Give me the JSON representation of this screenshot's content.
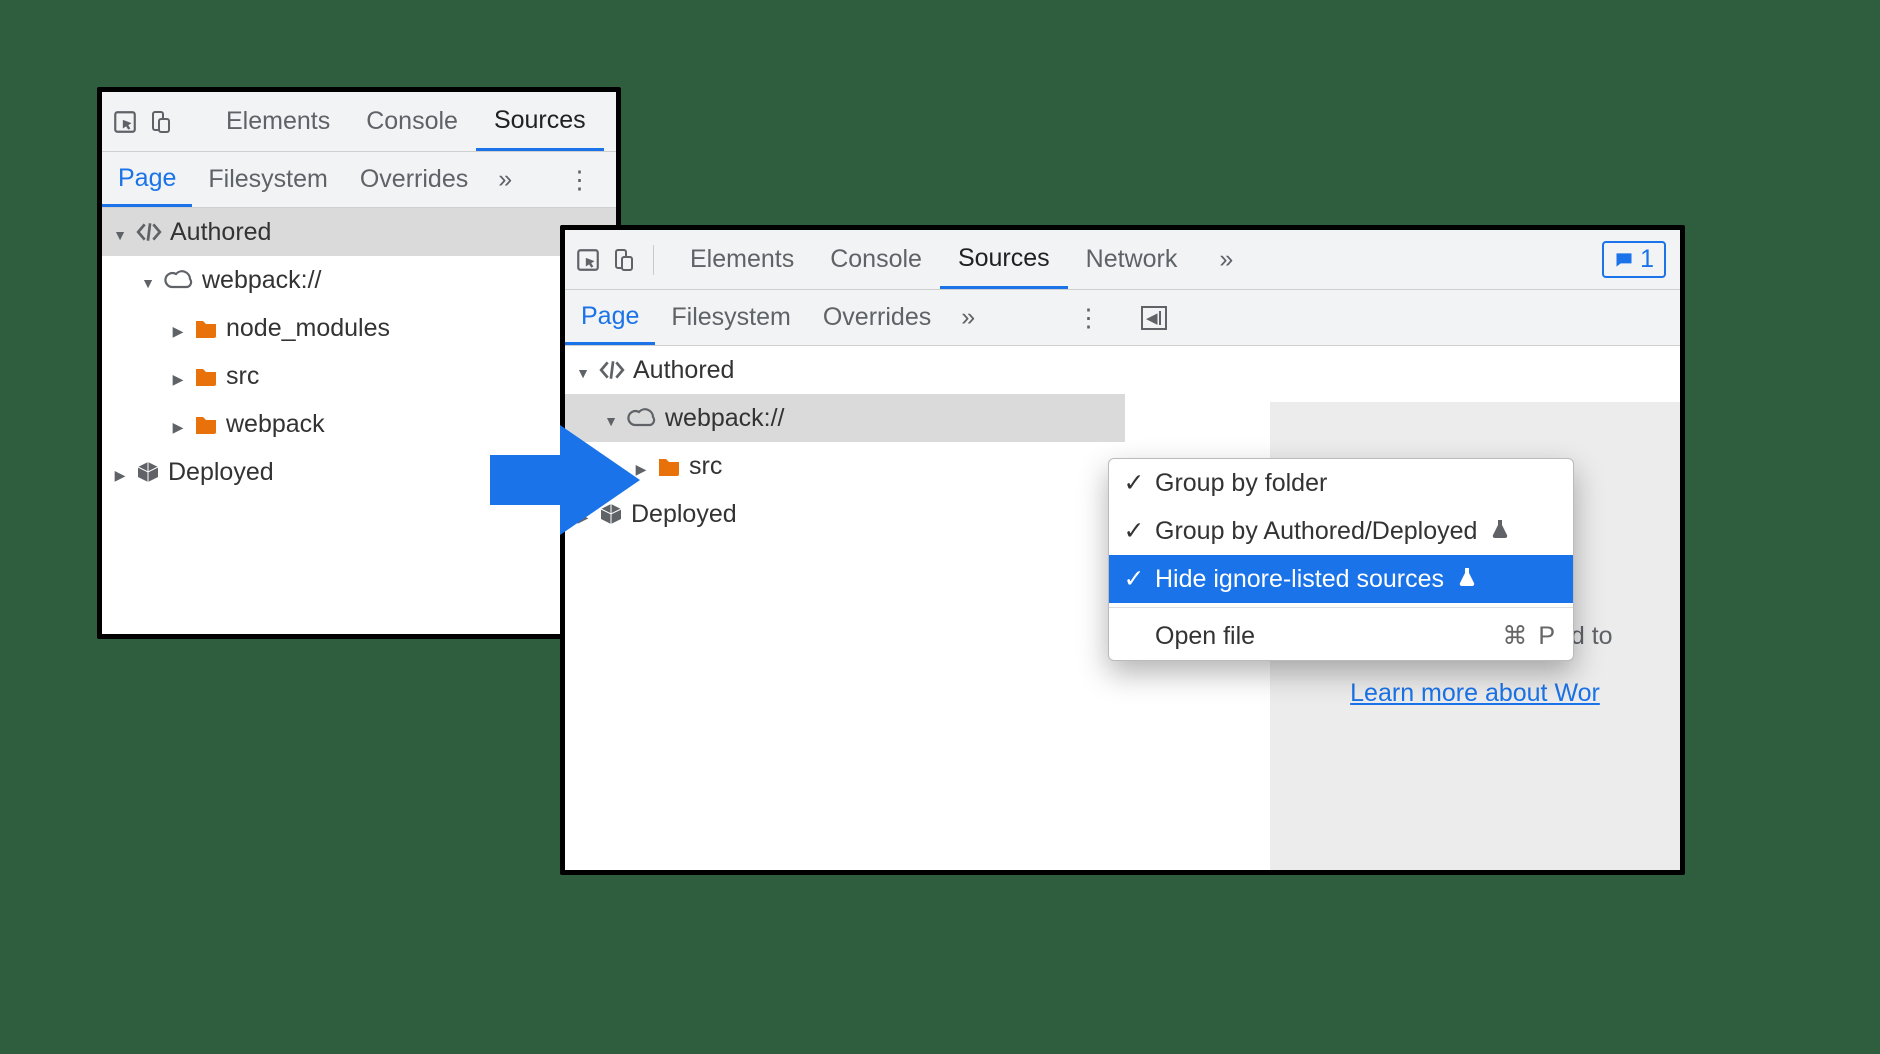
{
  "topbar": {
    "tabs": {
      "elements": "Elements",
      "console": "Console",
      "sources": "Sources",
      "network": "Network"
    },
    "more_chevron": "»",
    "issues_count": "1"
  },
  "subbar": {
    "tabs": {
      "page": "Page",
      "filesystem": "Filesystem",
      "overrides": "Overrides"
    },
    "more_chevron": "»"
  },
  "left_tree": {
    "authored": "Authored",
    "webpack": "webpack://",
    "node_modules": "node_modules",
    "src": "src",
    "webpack_dir": "webpack",
    "deployed": "Deployed"
  },
  "right_tree": {
    "authored": "Authored",
    "webpack": "webpack://",
    "src": "src",
    "deployed": "Deployed"
  },
  "context_menu": {
    "group_by_folder": "Group by folder",
    "group_by_authored": "Group by Authored/Deployed",
    "hide_ignore_listed": "Hide ignore-listed sources",
    "open_file": "Open file",
    "open_file_shortcut": "⌘ P"
  },
  "right_pane": {
    "drop_text": "Drop in a folder to add to",
    "learn_more": "Learn more about Wor"
  },
  "colors": {
    "accent": "#1a73e8",
    "folder": "#e8710a",
    "bg_green": "#2e5e3e"
  }
}
